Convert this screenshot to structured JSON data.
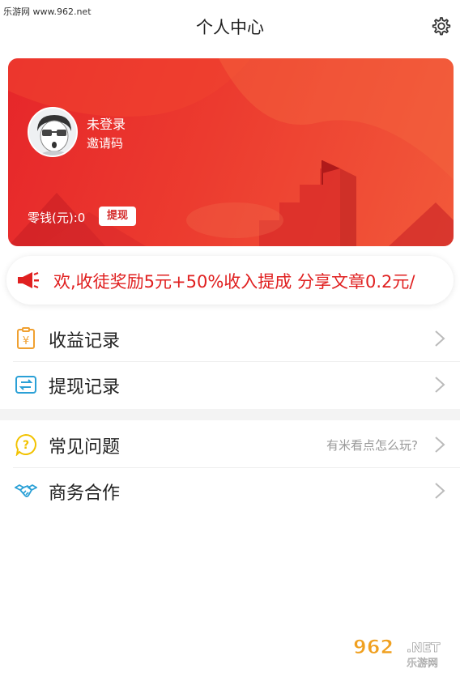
{
  "watermark": {
    "top": "乐游网 www.962.net",
    "logo_num": "962",
    "logo_net": ".NET",
    "logo_cn": "乐游网"
  },
  "header": {
    "title": "个人中心"
  },
  "profile": {
    "name": "未登录",
    "invite_label": "邀请码",
    "balance_text": "零钱(元):0",
    "withdraw_label": "提现"
  },
  "marquee": {
    "text": "欢,收徒奖励5元+50%收入提成  分享文章0.2元/"
  },
  "menu": [
    {
      "label": "收益记录",
      "icon": "receipt-yen-icon"
    },
    {
      "label": "提现记录",
      "icon": "wallet-transfer-icon"
    },
    {
      "label": "常见问题",
      "icon": "question-bubble-icon",
      "hint": "有米看点怎么玩?"
    },
    {
      "label": "商务合作",
      "icon": "handshake-icon"
    }
  ],
  "colors": {
    "brand_red": "#e6262a",
    "marquee_red": "#e02020",
    "icon_orange": "#f0a030",
    "icon_blue": "#2aa0d6",
    "icon_yellow": "#f2c200"
  }
}
